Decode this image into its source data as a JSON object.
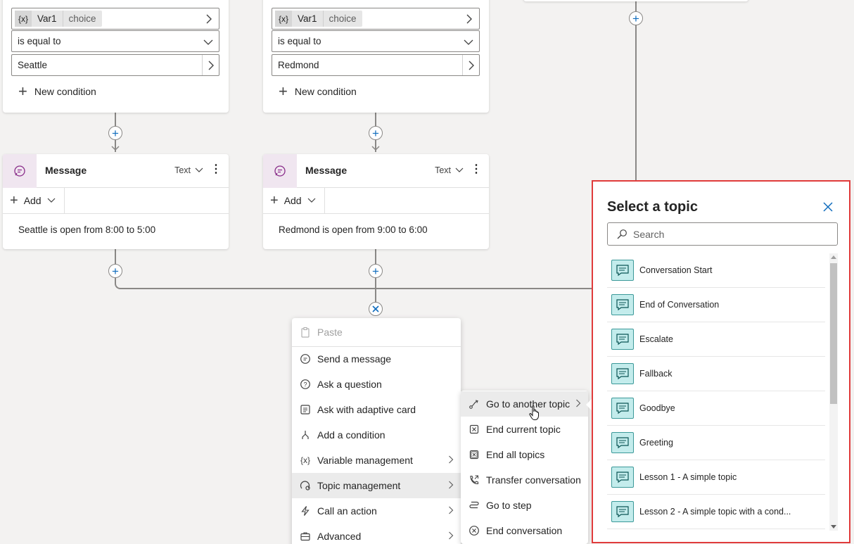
{
  "condition_left": {
    "var_icon": "{x}",
    "var_name": "Var1",
    "var_type": "choice",
    "operator": "is equal to",
    "value": "Seattle",
    "new_condition": "New condition"
  },
  "condition_right": {
    "var_icon": "{x}",
    "var_name": "Var1",
    "var_type": "choice",
    "operator": "is equal to",
    "value": "Redmond",
    "new_condition": "New condition"
  },
  "message_left": {
    "title": "Message",
    "type": "Text",
    "add_label": "Add",
    "text": "Seattle is open from 8:00 to 5:00"
  },
  "message_right": {
    "title": "Message",
    "type": "Text",
    "add_label": "Add",
    "text": "Redmond is open from 9:00 to 6:00"
  },
  "node_menu": {
    "items": [
      {
        "label": "Paste",
        "icon": "paste-icon",
        "disabled": true
      },
      {
        "label": "Send a message",
        "icon": "message-icon"
      },
      {
        "label": "Ask a question",
        "icon": "question-icon"
      },
      {
        "label": "Ask with adaptive card",
        "icon": "adaptive-card-icon"
      },
      {
        "label": "Add a condition",
        "icon": "condition-icon"
      },
      {
        "label": "Variable management",
        "icon": "variable-icon",
        "submenu": true
      },
      {
        "label": "Topic management",
        "icon": "topic-management-icon",
        "submenu": true,
        "selected": true
      },
      {
        "label": "Call an action",
        "icon": "action-icon",
        "submenu": true
      },
      {
        "label": "Advanced",
        "icon": "advanced-icon",
        "submenu": true
      }
    ]
  },
  "topic_submenu": {
    "items": [
      {
        "label": "Go to another topic",
        "icon": "redirect-icon",
        "submenu": true,
        "selected": true
      },
      {
        "label": "End current topic",
        "icon": "end-topic-icon"
      },
      {
        "label": "End all topics",
        "icon": "end-all-icon"
      },
      {
        "label": "Transfer conversation",
        "icon": "transfer-icon"
      },
      {
        "label": "Go to step",
        "icon": "go-to-step-icon"
      },
      {
        "label": "End conversation",
        "icon": "end-conversation-icon"
      }
    ]
  },
  "topic_panel": {
    "title": "Select a topic",
    "search_placeholder": "Search",
    "topics": [
      "Conversation Start",
      "End of Conversation",
      "Escalate",
      "Fallback",
      "Goodbye",
      "Greeting",
      "Lesson 1 - A simple topic",
      "Lesson 2 - A simple topic with a cond..."
    ],
    "highlight_color": "#e03b3b"
  },
  "colors": {
    "canvas": "#f3f2f1",
    "accent": "#0f6cbd",
    "message_icon_bg": "#f0e6f0",
    "topic_icon_bg": "#c3ecec"
  }
}
